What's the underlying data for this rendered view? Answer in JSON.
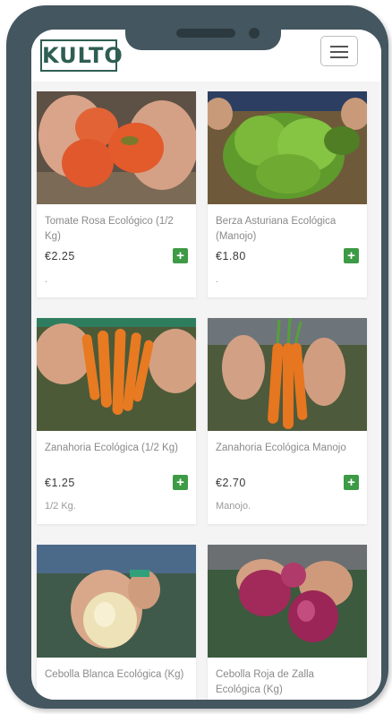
{
  "header": {
    "logo_text": "KULTO",
    "menu_icon": "hamburger-menu-icon"
  },
  "products": [
    {
      "title": "Tomate Rosa Ecológico (1/2 Kg)",
      "price": "€2.25",
      "unit": ".",
      "image": "tomatoes"
    },
    {
      "title": "Berza Asturiana Ecológica (Manojo)",
      "price": "€1.80",
      "unit": ".",
      "image": "cabbage"
    },
    {
      "title": "Zanahoria Ecológica (1/2 Kg)",
      "price": "€1.25",
      "unit": "1/2 Kg.",
      "image": "carrots"
    },
    {
      "title": "Zanahoria Ecológica Manojo",
      "price": "€2.70",
      "unit": "Manojo.",
      "image": "carrot-bunch"
    },
    {
      "title": "Cebolla Blanca Ecológica (Kg)",
      "price": "",
      "unit": "",
      "image": "white-onion"
    },
    {
      "title": "Cebolla Roja de Zalla Ecológica (Kg)",
      "price": "",
      "unit": "",
      "image": "red-onions"
    }
  ],
  "add_label": "+",
  "colors": {
    "frame": "#44565f",
    "brand": "#2f5e53",
    "add_button": "#3d9a45"
  }
}
